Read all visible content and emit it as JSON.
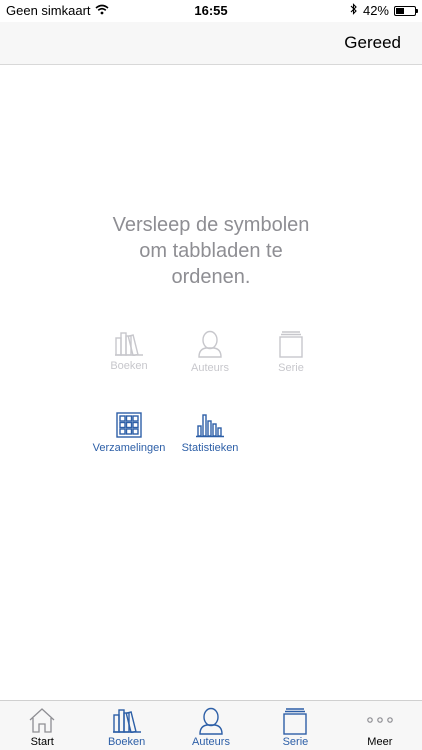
{
  "status_bar": {
    "carrier": "Geen simkaart",
    "time": "16:55",
    "battery_percent": "42%",
    "battery_level": 0.42
  },
  "nav": {
    "done_label": "Gereed"
  },
  "instruction": {
    "line1": "Versleep de symbolen",
    "line2": "om tabbladen te",
    "line3": "ordenen."
  },
  "dimmed_items": [
    {
      "label": "Boeken",
      "icon": "books-icon"
    },
    {
      "label": "Auteurs",
      "icon": "person-icon"
    },
    {
      "label": "Serie",
      "icon": "stack-icon"
    }
  ],
  "available_items": [
    {
      "label": "Verzamelingen",
      "icon": "grid-icon"
    },
    {
      "label": "Statistieken",
      "icon": "bar-chart-icon"
    }
  ],
  "tab_bar": {
    "tabs": [
      {
        "label": "Start",
        "icon": "house-icon"
      },
      {
        "label": "Boeken",
        "icon": "books-icon"
      },
      {
        "label": "Auteurs",
        "icon": "person-icon"
      },
      {
        "label": "Serie",
        "icon": "stack-icon"
      },
      {
        "label": "Meer",
        "icon": "more-icon"
      }
    ]
  },
  "colors": {
    "accent": "#2d5fa7",
    "dimmed": "#c7c7cc",
    "instruction_text": "#8e8e93"
  }
}
